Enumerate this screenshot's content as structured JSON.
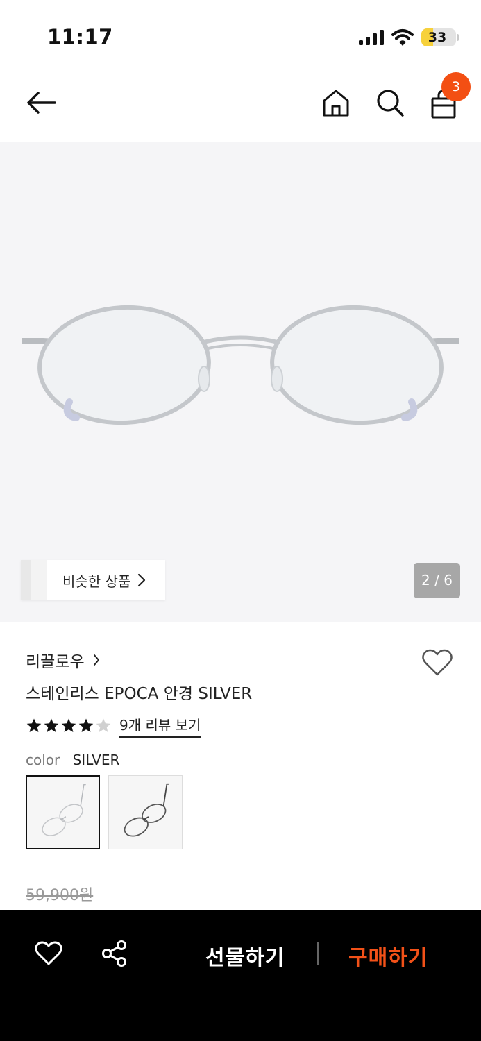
{
  "status": {
    "time": "11:17",
    "battery": "33",
    "battery_level": 0.33
  },
  "nav": {
    "cart_count": "3",
    "icons": [
      "back-arrow-icon",
      "home-icon",
      "search-icon",
      "shopping-bag-icon"
    ]
  },
  "gallery": {
    "similar_label": "비슷한 상품",
    "page_indicator": "2 / 6"
  },
  "product": {
    "brand": "리끌로우",
    "title": "스테인리스 EPOCA 안경 SILVER",
    "rating": 4,
    "rating_max": 5,
    "review_link": "9개 리뷰 보기",
    "color_label": "color",
    "color_value": "SILVER",
    "original_price": "59,900원"
  },
  "bottom_bar": {
    "gift_label": "선물하기",
    "buy_label": "구매하기",
    "icons": [
      "heart-icon",
      "share-icon"
    ]
  },
  "colors": {
    "accent": "#f25118",
    "badge": "#f34f13",
    "battery": "#f7d13b"
  }
}
